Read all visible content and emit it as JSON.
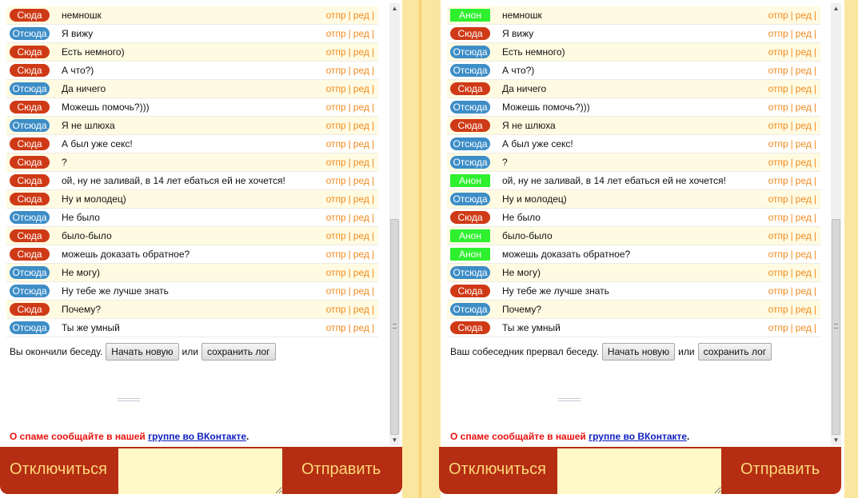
{
  "colors": {
    "badge_red": "#cf3a16",
    "badge_blue": "#3d8dc7",
    "badge_green": "#2ef02e",
    "bar": "#b52d12",
    "bar_text": "#fbd97a",
    "action_orange": "#f08a1e",
    "spam_red": "#e8110f",
    "link_blue": "#1020c0"
  },
  "actions": {
    "send": "отпр",
    "edit": "ред",
    "sep": "|"
  },
  "left": {
    "messages": [
      {
        "badge": "Сюда",
        "color": "red",
        "text": "немношк"
      },
      {
        "badge": "Отсюда",
        "color": "blue",
        "text": "Я вижу"
      },
      {
        "badge": "Сюда",
        "color": "red",
        "text": "Есть немного)"
      },
      {
        "badge": "Сюда",
        "color": "red",
        "text": "А что?)"
      },
      {
        "badge": "Отсюда",
        "color": "blue",
        "text": "Да ничего"
      },
      {
        "badge": "Сюда",
        "color": "red",
        "text": "Можешь помочь?)))"
      },
      {
        "badge": "Отсюда",
        "color": "blue",
        "text": "Я не шлюха"
      },
      {
        "badge": "Сюда",
        "color": "red",
        "text": "А был уже секс!"
      },
      {
        "badge": "Сюда",
        "color": "red",
        "text": "?"
      },
      {
        "badge": "Сюда",
        "color": "red",
        "text": "ой, ну не заливай, в 14 лет ебаться ей не хочется!"
      },
      {
        "badge": "Сюда",
        "color": "red",
        "text": "Ну и молодец)"
      },
      {
        "badge": "Отсюда",
        "color": "blue",
        "text": "Не было"
      },
      {
        "badge": "Сюда",
        "color": "red",
        "text": "было-было"
      },
      {
        "badge": "Сюда",
        "color": "red",
        "text": "можешь доказать обратное?"
      },
      {
        "badge": "Отсюда",
        "color": "blue",
        "text": "Не могу)"
      },
      {
        "badge": "Отсюда",
        "color": "blue",
        "text": "Ну тебе же лучше знать"
      },
      {
        "badge": "Сюда",
        "color": "red",
        "text": "Почему?"
      },
      {
        "badge": "Отсюда",
        "color": "blue",
        "text": "Ты же умный"
      }
    ],
    "end_text": "Вы окончили беседу.",
    "new_button": "Начать новую",
    "or_text": "или",
    "save_button": "сохранить лог",
    "spam_text": "О спаме сообщайте в нашей",
    "spam_link": "группе во ВКонтакте",
    "spam_dot": ".",
    "disconnect_label": "Отключиться",
    "send_label": "Отправить"
  },
  "right": {
    "messages": [
      {
        "badge": "Анон",
        "color": "green",
        "text": "немношк"
      },
      {
        "badge": "Сюда",
        "color": "red",
        "text": "Я вижу"
      },
      {
        "badge": "Отсюда",
        "color": "blue",
        "text": "Есть немного)"
      },
      {
        "badge": "Отсюда",
        "color": "blue",
        "text": "А что?)"
      },
      {
        "badge": "Сюда",
        "color": "red",
        "text": "Да ничего"
      },
      {
        "badge": "Отсюда",
        "color": "blue",
        "text": "Можешь помочь?)))"
      },
      {
        "badge": "Сюда",
        "color": "red",
        "text": "Я не шлюха"
      },
      {
        "badge": "Отсюда",
        "color": "blue",
        "text": "А был уже секс!"
      },
      {
        "badge": "Отсюда",
        "color": "blue",
        "text": "?"
      },
      {
        "badge": "Анон",
        "color": "green",
        "text": "ой, ну не заливай, в 14 лет ебаться ей не хочется!"
      },
      {
        "badge": "Отсюда",
        "color": "blue",
        "text": "Ну и молодец)"
      },
      {
        "badge": "Сюда",
        "color": "red",
        "text": "Не было"
      },
      {
        "badge": "Анон",
        "color": "green",
        "text": "было-было"
      },
      {
        "badge": "Анон",
        "color": "green",
        "text": "можешь доказать обратное?"
      },
      {
        "badge": "Отсюда",
        "color": "blue",
        "text": "Не могу)"
      },
      {
        "badge": "Сюда",
        "color": "red",
        "text": "Ну тебе же лучше знать"
      },
      {
        "badge": "Отсюда",
        "color": "blue",
        "text": "Почему?"
      },
      {
        "badge": "Сюда",
        "color": "red",
        "text": "Ты же умный"
      }
    ],
    "end_text": "Ваш собеседник прервал беседу.",
    "new_button": "Начать новую",
    "or_text": "или",
    "save_button": "сохранить лог",
    "spam_text": "О спаме сообщайте в нашей",
    "spam_link": "группе во ВКонтакте",
    "spam_dot": ".",
    "disconnect_label": "Отключиться",
    "send_label": "Отправить"
  }
}
